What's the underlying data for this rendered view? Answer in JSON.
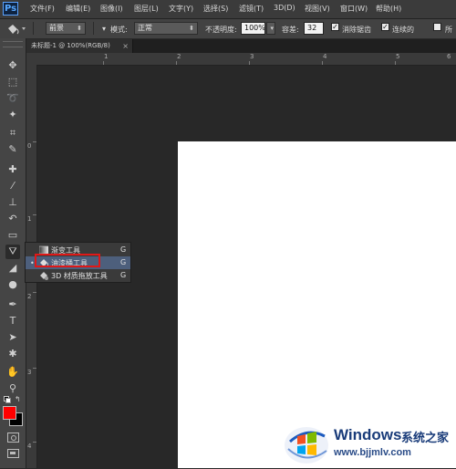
{
  "app": {
    "logo_text": "Ps"
  },
  "menu": [
    "文件(F)",
    "编辑(E)",
    "图像(I)",
    "图层(L)",
    "文字(Y)",
    "选择(S)",
    "滤镜(T)",
    "3D(D)",
    "视图(V)",
    "窗口(W)",
    "帮助(H)"
  ],
  "options": {
    "fill_source": "前景",
    "mode_label": "模式:",
    "mode_value": "正常",
    "opacity_label": "不透明度:",
    "opacity_value": "100%",
    "tolerance_label": "容差:",
    "tolerance_value": "32",
    "antialias_label": "消除锯齿",
    "antialias_checked": true,
    "contiguous_label": "连续的",
    "contiguous_checked": true,
    "all_layers_label": "所",
    "all_layers_checked": false
  },
  "document_tab": {
    "title": "未标题-1 @ 100%(RGB/8)",
    "close": "×"
  },
  "rulers": {
    "top": [
      "1",
      "2",
      "3",
      "4",
      "5",
      "6"
    ],
    "left": [
      "0",
      "1",
      "2",
      "3",
      "4"
    ]
  },
  "flyout": {
    "items": [
      {
        "label": "渐变工具",
        "key": "G",
        "icon": "gradient-icon",
        "selected": false
      },
      {
        "label": "油漆桶工具",
        "key": "G",
        "icon": "paint-bucket-icon",
        "selected": true
      },
      {
        "label": "3D 材质拖放工具",
        "key": "G",
        "icon": "3d-material-drop-icon",
        "selected": false
      }
    ],
    "bullet": "•"
  },
  "toolbar": {
    "tools": [
      "move-icon",
      "marquee-icon",
      "lasso-icon",
      "magic-wand-icon",
      "crop-icon",
      "eyedropper-icon",
      "healing-brush-icon",
      "brush-icon",
      "clone-stamp-icon",
      "history-brush-icon",
      "eraser-icon",
      "paint-bucket-icon",
      "blur-icon",
      "dodge-icon",
      "pen-icon",
      "type-icon",
      "path-selection-icon",
      "shape-icon",
      "hand-icon",
      "zoom-icon"
    ],
    "foreground_color": "#ff0000",
    "background_color": "#000000"
  },
  "watermark": {
    "title": "Windows",
    "subtitle": "系统之家",
    "url": "www.bjjmlv.com"
  },
  "colors": {
    "highlight_border": "#e01818",
    "selected_row": "#4d5f7c",
    "canvas": "#ffffff"
  }
}
